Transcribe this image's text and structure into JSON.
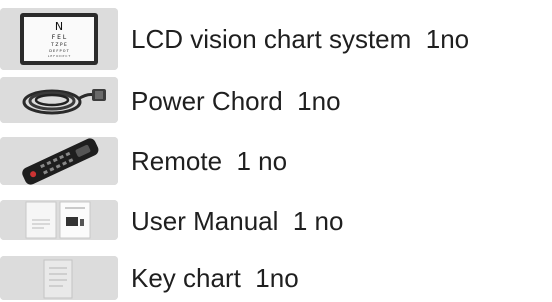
{
  "items": [
    {
      "label": "LCD vision chart system  1no",
      "icon": "lcd-monitor-icon"
    },
    {
      "label": "Power Chord  1no",
      "icon": "power-cord-icon"
    },
    {
      "label": "Remote  1 no",
      "icon": "remote-control-icon"
    },
    {
      "label": "User Manual  1 no",
      "icon": "manual-booklet-icon"
    },
    {
      "label": "Key chart  1no",
      "icon": "key-chart-icon"
    }
  ],
  "colors": {
    "thumb_background": "#dcdcdc",
    "text": "#1f1f1f"
  }
}
